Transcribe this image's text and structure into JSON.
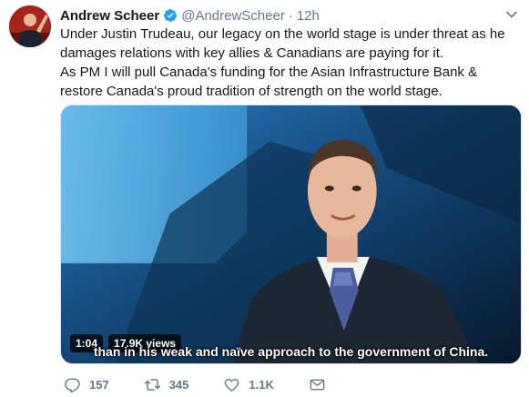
{
  "tweet": {
    "author_name": "Andrew Scheer",
    "handle": "@AndrewScheer",
    "separator": "·",
    "time": "12h",
    "paragraph_1": "Under Justin Trudeau, our legacy on the world stage is under threat as he damages relations with key allies & Canadians are paying for it.",
    "paragraph_2": "As PM I will pull Canada's funding for the Asian Infrastructure Bank & restore Canada's proud tradition of strength on the world stage."
  },
  "video": {
    "duration": "1:04",
    "views": "17.9K views",
    "subtitle": "than in his weak and naïve approach to the government of China."
  },
  "actions": {
    "replies": "157",
    "retweets": "345",
    "likes": "1.1K"
  },
  "colors": {
    "verified_blue": "#1da1f2",
    "meta_gray": "#657786",
    "text": "#14171a"
  }
}
